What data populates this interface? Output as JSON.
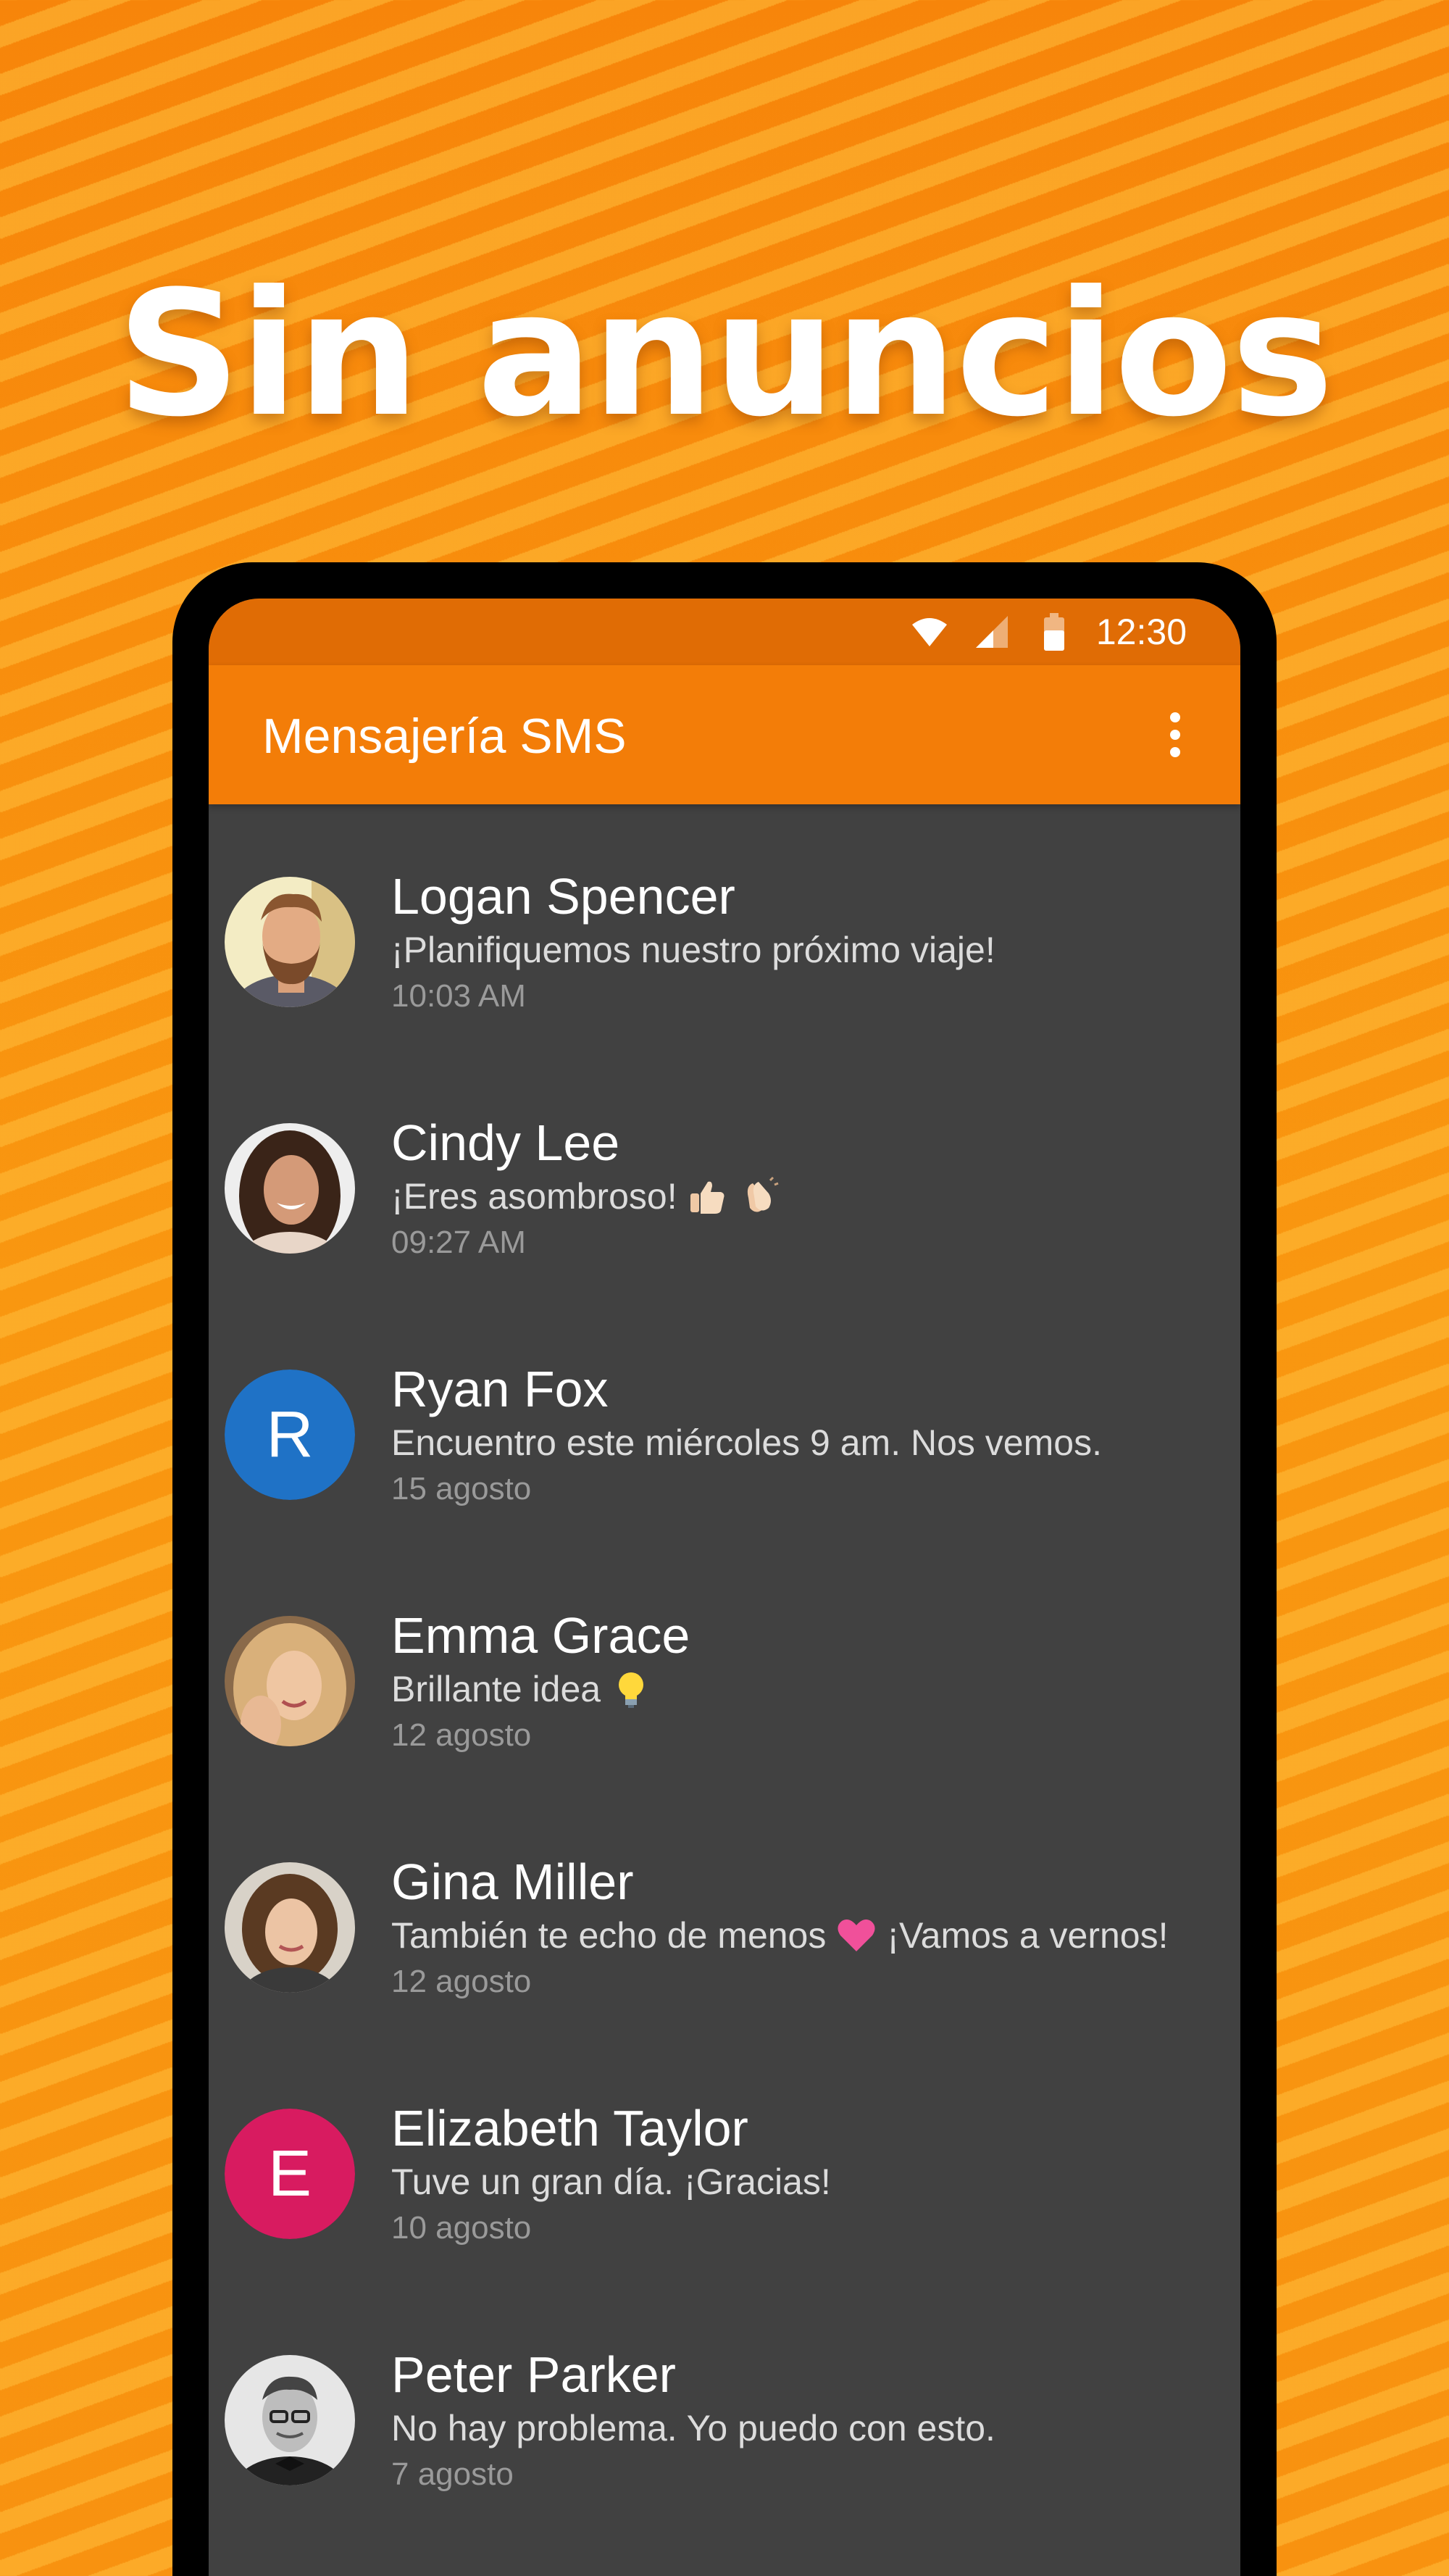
{
  "headline": "Sin anuncios",
  "status_bar": {
    "time": "12:30",
    "icons": [
      "wifi-icon",
      "cell-signal-icon",
      "battery-icon"
    ]
  },
  "app_bar": {
    "title": "Mensajería SMS",
    "menu_icon": "more-vert-icon"
  },
  "colors": {
    "background_orange": "#f79a0c",
    "app_bar": "#f37d08",
    "status_bar": "#e06c05",
    "list_background": "#414141",
    "avatar_blue": "#1f72c6",
    "avatar_pink": "#d81b60"
  },
  "conversations": [
    {
      "name": "Logan Spencer",
      "preview": "¡Planifiquemos nuestro próximo viaje!",
      "time": "10:03 AM",
      "avatar": "photo"
    },
    {
      "name": "Cindy Lee",
      "preview": "¡Eres asombroso!",
      "time": "09:27 AM",
      "avatar": "photo",
      "emojis": [
        "thumbs-up-emoji",
        "clapping-hands-emoji"
      ]
    },
    {
      "name": "Ryan Fox",
      "preview": "Encuentro este miércoles 9 am. Nos vemos.",
      "time": "15 agosto",
      "avatar": "letter",
      "letter": "R"
    },
    {
      "name": "Emma Grace",
      "preview": "Brillante idea",
      "time": "12 agosto",
      "avatar": "photo",
      "emojis": [
        "light-bulb-emoji"
      ]
    },
    {
      "name": "Gina Miller",
      "preview_before": "También te echo de menos",
      "preview_after": "¡Vamos a vernos!",
      "time": "12 agosto",
      "avatar": "photo",
      "emojis": [
        "heart-emoji"
      ]
    },
    {
      "name": "Elizabeth Taylor",
      "preview": "Tuve un gran día. ¡Gracias!",
      "time": "10 agosto",
      "avatar": "letter",
      "letter": "E"
    },
    {
      "name": "Peter Parker",
      "preview": "No hay problema. Yo puedo con esto.",
      "time": "7 agosto",
      "avatar": "photo"
    }
  ]
}
